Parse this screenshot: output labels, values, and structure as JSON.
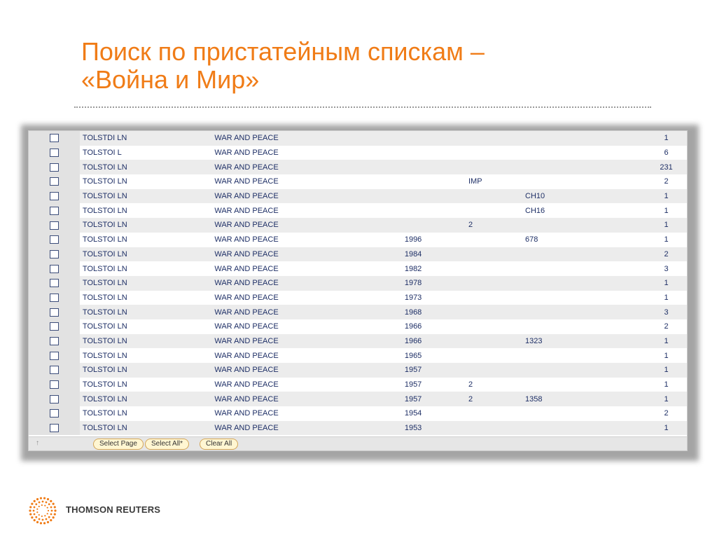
{
  "slide": {
    "title_line1": "Поиск по пристатейным спискам –",
    "title_line2": "«Война и Мир»"
  },
  "results": {
    "rows": [
      {
        "author": "TOLSTDI LN",
        "work": "WAR AND PEACE",
        "year": "",
        "vol": "",
        "page": "",
        "count": "1"
      },
      {
        "author": "TOLSTOI L",
        "work": "WAR AND PEACE",
        "year": "",
        "vol": "",
        "page": "",
        "count": "6"
      },
      {
        "author": "TOLSTOI LN",
        "work": "WAR AND PEACE",
        "year": "",
        "vol": "",
        "page": "",
        "count": "231"
      },
      {
        "author": "TOLSTOI LN",
        "work": "WAR AND PEACE",
        "year": "",
        "vol": "IMP",
        "page": "",
        "count": "2"
      },
      {
        "author": "TOLSTOI LN",
        "work": "WAR AND PEACE",
        "year": "",
        "vol": "",
        "page": "CH10",
        "count": "1"
      },
      {
        "author": "TOLSTOI LN",
        "work": "WAR AND PEACE",
        "year": "",
        "vol": "",
        "page": "CH16",
        "count": "1"
      },
      {
        "author": "TOLSTOI LN",
        "work": "WAR AND PEACE",
        "year": "",
        "vol": "2",
        "page": "",
        "count": "1"
      },
      {
        "author": "TOLSTOI LN",
        "work": "WAR AND PEACE",
        "year": "1996",
        "vol": "",
        "page": "678",
        "count": "1"
      },
      {
        "author": "TOLSTOI LN",
        "work": "WAR AND PEACE",
        "year": "1984",
        "vol": "",
        "page": "",
        "count": "2"
      },
      {
        "author": "TOLSTOI LN",
        "work": "WAR AND PEACE",
        "year": "1982",
        "vol": "",
        "page": "",
        "count": "3"
      },
      {
        "author": "TOLSTOI LN",
        "work": "WAR AND PEACE",
        "year": "1978",
        "vol": "",
        "page": "",
        "count": "1"
      },
      {
        "author": "TOLSTOI LN",
        "work": "WAR AND PEACE",
        "year": "1973",
        "vol": "",
        "page": "",
        "count": "1"
      },
      {
        "author": "TOLSTOI LN",
        "work": "WAR AND PEACE",
        "year": "1968",
        "vol": "",
        "page": "",
        "count": "3"
      },
      {
        "author": "TOLSTOI LN",
        "work": "WAR AND PEACE",
        "year": "1966",
        "vol": "",
        "page": "",
        "count": "2"
      },
      {
        "author": "TOLSTOI LN",
        "work": "WAR AND PEACE",
        "year": "1966",
        "vol": "",
        "page": "1323",
        "count": "1"
      },
      {
        "author": "TOLSTOI LN",
        "work": "WAR AND PEACE",
        "year": "1965",
        "vol": "",
        "page": "",
        "count": "1"
      },
      {
        "author": "TOLSTOI LN",
        "work": "WAR AND PEACE",
        "year": "1957",
        "vol": "",
        "page": "",
        "count": "1"
      },
      {
        "author": "TOLSTOI LN",
        "work": "WAR AND PEACE",
        "year": "1957",
        "vol": "2",
        "page": "",
        "count": "1"
      },
      {
        "author": "TOLSTOI LN",
        "work": "WAR AND PEACE",
        "year": "1957",
        "vol": "2",
        "page": "1358",
        "count": "1"
      },
      {
        "author": "TOLSTOI LN",
        "work": "WAR AND PEACE",
        "year": "1954",
        "vol": "",
        "page": "",
        "count": "2"
      },
      {
        "author": "TOLSTOI LN",
        "work": "WAR AND PEACE",
        "year": "1953",
        "vol": "",
        "page": "",
        "count": "1"
      }
    ]
  },
  "footer": {
    "up_icon": "up-arrow-icon",
    "select_page_label": "Select Page",
    "select_all_label": "Select All*",
    "clear_all_label": "Clear All"
  },
  "brand": {
    "name": "THOMSON REUTERS",
    "logo_icon": "thomson-reuters-dots-logo",
    "logo_color": "#f07c17"
  },
  "colors": {
    "title": "#f07c17",
    "row_text": "#1e2f66",
    "row_alt": "#ececec"
  }
}
